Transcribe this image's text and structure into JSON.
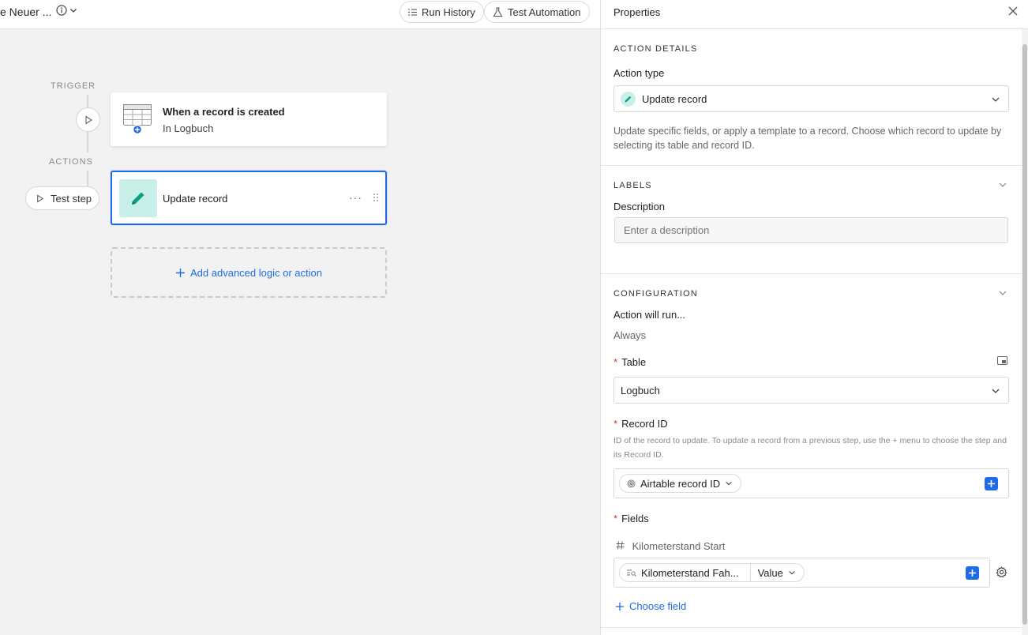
{
  "canvas": {
    "workflow_title": "e Neuer ...",
    "run_history_label": "Run History",
    "test_automation_label": "Test Automation",
    "trigger_label": "TRIGGER",
    "actions_label": "ACTIONS",
    "test_step_label": "Test step",
    "trigger_card": {
      "title": "When a record is created",
      "subtitle": "In Logbuch"
    },
    "action_card": {
      "title": "Update record",
      "more": "···"
    },
    "add_logic_label": "Add advanced logic or action"
  },
  "panel": {
    "title": "Properties",
    "action_details": {
      "heading": "ACTION DETAILS",
      "action_type_label": "Action type",
      "action_type_value": "Update record",
      "description": "Update specific fields, or apply a template to a record. Choose which record to update by selecting its table and record ID."
    },
    "labels": {
      "heading": "LABELS",
      "description_label": "Description",
      "description_placeholder": "Enter a description"
    },
    "configuration": {
      "heading": "CONFIGURATION",
      "run_label": "Action will run...",
      "run_value": "Always",
      "table_label": "Table",
      "table_value": "Logbuch",
      "record_id_label": "Record ID",
      "record_id_help": "ID of the record to update. To update a record from a previous step, use the + menu to choose the step and its Record ID.",
      "record_id_chip": "Airtable record ID",
      "fields_label": "Fields",
      "field_name": "Kilometerstand Start",
      "field_token": "Kilometerstand Fah...",
      "field_token_sub": "Value",
      "choose_field_label": "Choose field",
      "required_mark": "*"
    }
  },
  "colors": {
    "accent": "#1f6ae6",
    "pencil_bg": "#c8f0e8",
    "pencil_fg": "#0e9f82",
    "required": "#d6372b"
  }
}
